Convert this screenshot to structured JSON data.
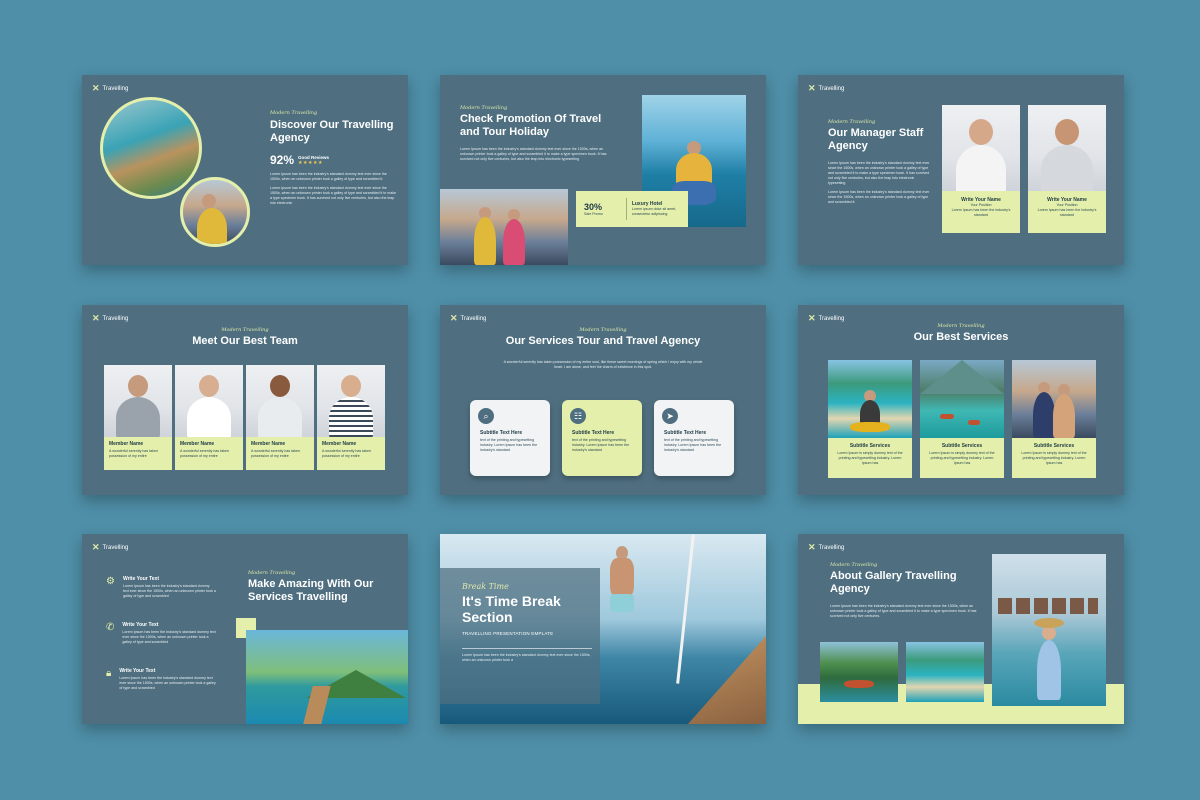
{
  "brand": {
    "name": "Travelling",
    "accent": "#e3efaa",
    "slide_bg": "#4f6f80",
    "page_bg": "#4f8fa8"
  },
  "slide1": {
    "kicker": "Modern Travelling",
    "title": "Discover Our Travelling Agency",
    "stat_value": "92%",
    "stat_label": "Good Reviews",
    "stars": "★★★★★",
    "para1": "Lorem Ipsum has been the industry's standard dummy text ever since the 1500s, when an unknown printer took a galley of type and scrambled it.",
    "para2": "Lorem Ipsum has been the industry's standard dummy text ever since the 1500s, when an unknown printer took a galley of type and scrambled it to make a type specimen book. It has survived not only five centuries, but also the leap into electronic"
  },
  "slide2": {
    "kicker": "Modern Travelling",
    "title": "Check Promotion Of Travel and Tour Holiday",
    "para": "Lorem Ipsum has been the industry's standard dummy text ever since the 1500s, when an unknown printer took a galley of type and scrambled it to make a type specimen book. It has survived not only five centuries, but also the leap into electronic typesetting",
    "promo_value": "30%",
    "promo_label": "Sale Promo",
    "hotel_title": "Luxury Hotel",
    "hotel_text": "Lorem ipsum dolor sit amet, consectetur adipiscing"
  },
  "slide3": {
    "kicker": "Modern Travelling",
    "title": "Our Manager Staff Agency",
    "para1": "Lorem Ipsum has been the industry's standard dummy text ever since the 1500s, when an unknown printer took a galley of type and scrambled it to make a type specimen book. It has survived not only five centuries, but also the leap into electronic typesetting",
    "para2": "Lorem Ipsum has been the industry's standard dummy text ever since the 1500s, when an unknown printer took a galley of type and scrambled it.",
    "cards": [
      {
        "name": "Write Your Name",
        "role": "Your Position",
        "text": "Lorem Ipsum has been the industry's standard"
      },
      {
        "name": "Write Your Name",
        "role": "Your Position",
        "text": "Lorem Ipsum has been the industry's standard"
      }
    ]
  },
  "slide4": {
    "kicker": "Modern Travelling",
    "title": "Meet Our Best Team",
    "members": [
      {
        "name": "Member Name",
        "text": "A wonderful serenity has taken possession of my entire"
      },
      {
        "name": "Member Name",
        "text": "A wonderful serenity has taken possession of my entire"
      },
      {
        "name": "Member Name",
        "text": "A wonderful serenity has taken possession of my entire"
      },
      {
        "name": "Member Name",
        "text": "A wonderful serenity has taken possession of my entire"
      }
    ]
  },
  "slide5": {
    "kicker": "Modern Travelling",
    "title": "Our Services Tour and Travel Agency",
    "para": "A wonderful serenity has taken possession of my entire soul, like these sweet mornings of spring which I enjoy with my whole heart. I am alone, and feel the charm of existence in this spot.",
    "cards": [
      {
        "title": "Subtitle Text Here",
        "text": "text of the printing and typesetting industry. Lorem Ipsum has been the industry's standard",
        "icon": "search-icon"
      },
      {
        "title": "Subtitle Text Here",
        "text": "text of the printing and typesetting industry. Lorem Ipsum has been the industry's standard",
        "icon": "equalizer-icon"
      },
      {
        "title": "Subtitle Text Here",
        "text": "text of the printing and typesetting industry. Lorem Ipsum has been the industry's standard",
        "icon": "paper-plane-icon"
      }
    ]
  },
  "slide6": {
    "kicker": "Modern Travelling",
    "title": "Our Best Services",
    "cards": [
      {
        "title": "Subtitle Services",
        "text": "Lorem Ipsum is simply dummy text of the printing and typesetting industry. Lorem Ipsum has"
      },
      {
        "title": "Subtitle Services",
        "text": "Lorem Ipsum is simply dummy text of the printing and typesetting industry. Lorem Ipsum has"
      },
      {
        "title": "Subtitle Services",
        "text": "Lorem Ipsum is simply dummy text of the printing and typesetting industry. Lorem Ipsum has"
      }
    ]
  },
  "slide7": {
    "kicker": "Modern Travelling",
    "title": "Make Amazing With Our Services Travelling",
    "items": [
      {
        "title": "Write Your Text",
        "text": "Lorem Ipsum has been the industry's standard dummy text ever since the 1500s, when an unknown printer took a galley of type and scrambled",
        "icon": "gear-icon"
      },
      {
        "title": "Write Your Text",
        "text": "Lorem Ipsum has been the industry's standard dummy text ever since the 1500s, when an unknown printer took a galley of type and scrambled",
        "icon": "phone-icon"
      },
      {
        "title": "Write Your Text",
        "text": "Lorem Ipsum has been the industry's standard dummy text ever since the 1500s, when an unknown printer took a galley of type and scrambled",
        "icon": "lock-icon"
      }
    ]
  },
  "slide8": {
    "kicker": "Break Time",
    "title": "It's Time Break Section",
    "subtitle": "TRAVELLING PRESENTATION EMPLATE",
    "para": "Lorem Ipsum has been the industry's standard dummy text ever since the 1500s, when an unknown printer took a"
  },
  "slide9": {
    "kicker": "Modern Travelling",
    "title": "About Gallery Travelling Agency",
    "para": "Lorem Ipsum has been the industry's standard dummy text ever since the 1500s, when an unknown printer took a galley of type and scrambled it to make a type specimen book. It has survived not only five centuries."
  }
}
